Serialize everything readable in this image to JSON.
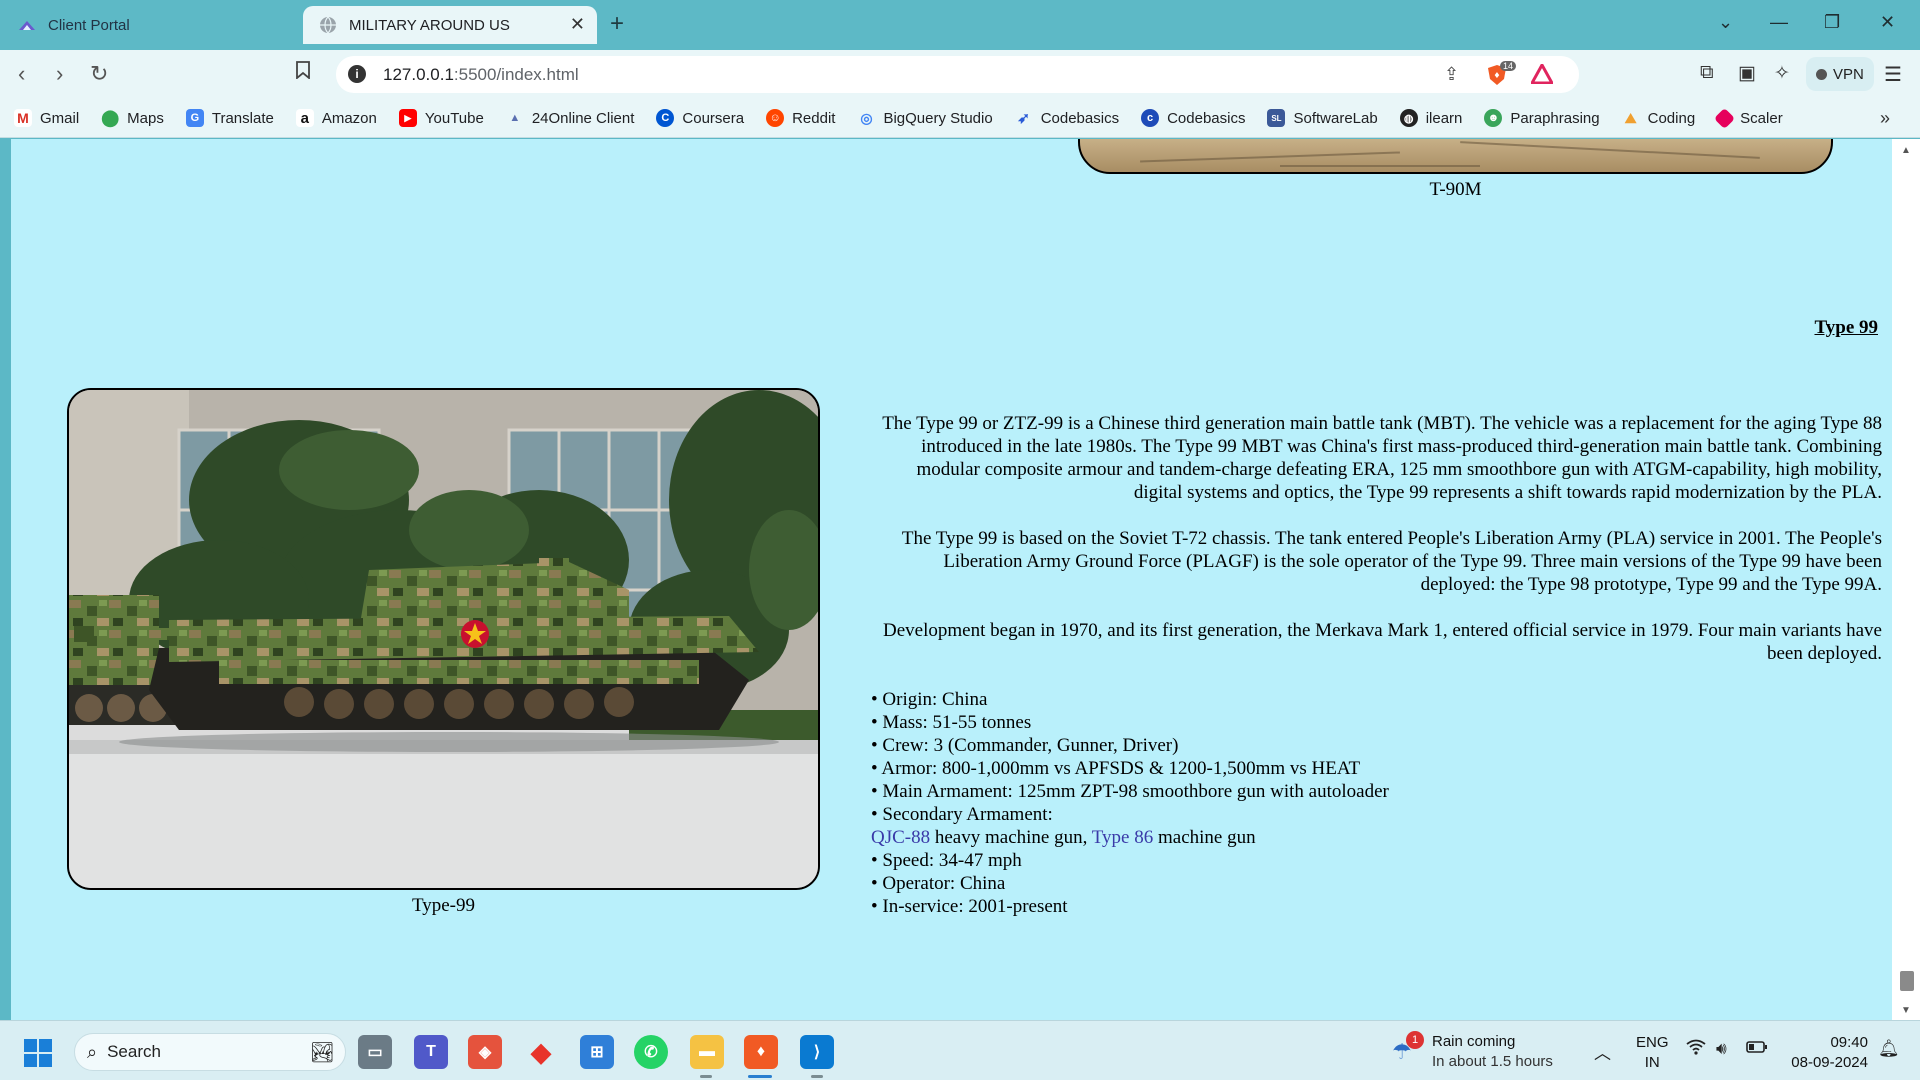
{
  "browser": {
    "tabs": [
      {
        "title": "Client Portal",
        "active": false
      },
      {
        "title": "MILITARY AROUND US",
        "active": true
      }
    ],
    "url_host": "127.0.0.1",
    "url_path": ":5500/index.html",
    "shield_count": "14",
    "vpn_label": "VPN",
    "bookmarks": [
      "Gmail",
      "Maps",
      "Translate",
      "Amazon",
      "YouTube",
      "24Online Client",
      "Coursera",
      "Reddit",
      "BigQuery Studio",
      "Codebasics",
      "Codebasics",
      "SoftwareLab",
      "ilearn",
      "Paraphrasing",
      "Coding",
      "Scaler"
    ]
  },
  "page": {
    "prev_caption": "T-90M",
    "section": {
      "heading": "Type 99",
      "image_caption": "Type-99",
      "paragraphs": [
        "The Type 99 or ZTZ-99 is a Chinese third generation main battle tank (MBT). The vehicle was a replacement for the aging Type 88 introduced in the late 1980s. The Type 99 MBT was China's first mass-produced third-generation main battle tank. Combining modular composite armour and tandem-charge defeating ERA, 125 mm smoothbore gun with ATGM-capability, high mobility, digital systems and optics, the Type 99 represents a shift towards rapid modernization by the PLA.",
        "The Type 99 is based on the Soviet T-72 chassis. The tank entered People's Liberation Army (PLA) service in 2001. The People's Liberation Army Ground Force (PLAGF) is the sole operator of the Type 99. Three main versions of the Type 99 have been deployed: the Type 98 prototype, Type 99 and the Type 99A.",
        "Development began in 1970, and its first generation, the Merkava Mark 1, entered official service in 1979. Four main variants have been deployed."
      ],
      "specs": {
        "origin": "• Origin: China",
        "mass": "• Mass: 51-55 tonnes",
        "crew": "• Crew: 3 (Commander, Gunner, Driver)",
        "armor": "• Armor: 800-1,000mm vs APFSDS & 1200-1,500mm vs HEAT",
        "main_armament": "• Main Armament: 125mm ZPT-98 smoothbore gun with autoloader",
        "secondary_armament": "• Secondary Armament:",
        "secondary_link1": "QJC-88",
        "secondary_mid": " heavy machine gun, ",
        "secondary_link2": "Type 86",
        "secondary_end": " machine gun",
        "speed": "• Speed: 34-47 mph",
        "operator": "• Operator: China",
        "in_service": "• In-service: 2001-present"
      }
    }
  },
  "taskbar": {
    "search_label": "Search",
    "weather_badge": "1",
    "weather_title": "Rain coming",
    "weather_sub": "In about 1.5 hours",
    "lang_line1": "ENG",
    "lang_line2": "IN",
    "time": "09:40",
    "date": "08-09-2024"
  },
  "colors": {
    "page_bg": "#b9f0fb",
    "chrome_bg": "#5db9c6",
    "link": "#3a3aa8"
  }
}
